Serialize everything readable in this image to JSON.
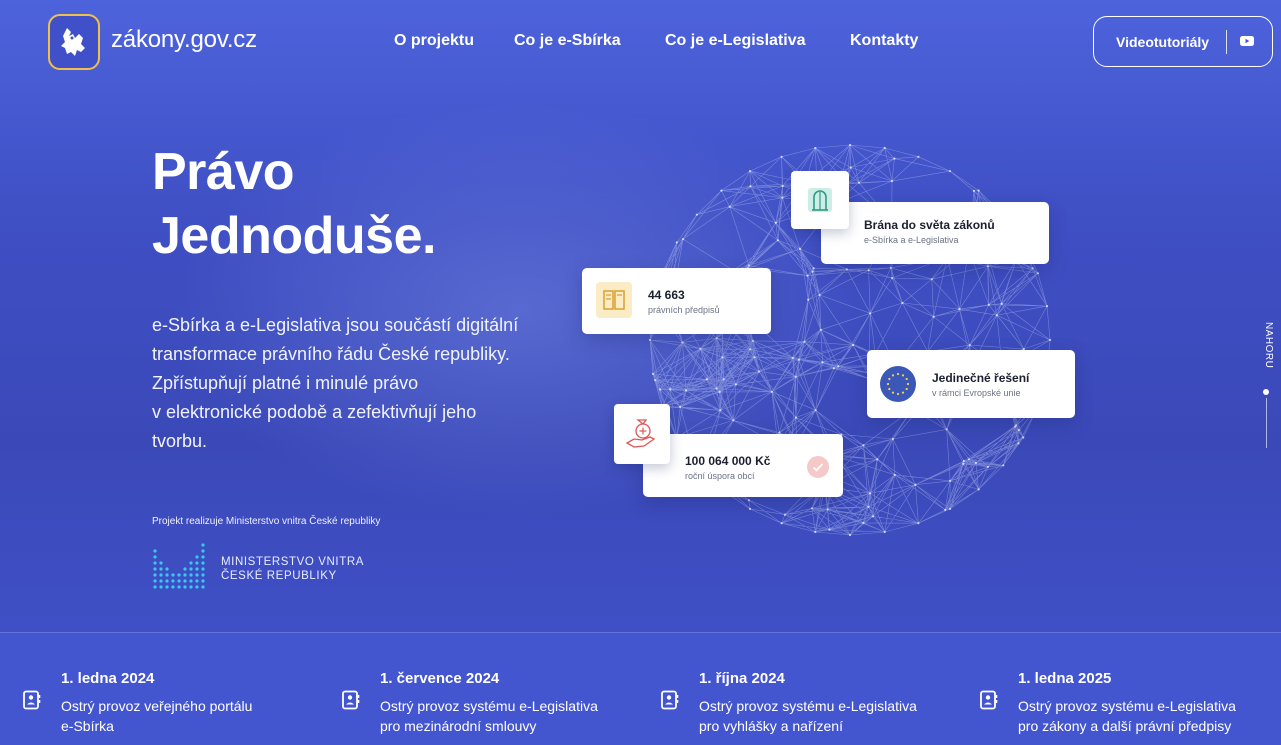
{
  "header": {
    "site_name": "zákony.gov.cz",
    "nav": [
      "O projektu",
      "Co je e-Sbírka",
      "Co je e-Legislativa",
      "Kontakty"
    ],
    "video_button": "Videotutoriály"
  },
  "hero": {
    "headline_line1": "Právo",
    "headline_line2": "Jednoduše.",
    "lead": [
      "e-Sbírka a e-Legislativa jsou součástí digitální",
      "transformace právního řádu České republiky.",
      "Zpřístupňují platné i minulé právo",
      "v elektronické podobě a zefektivňují jeho",
      "tvorbu."
    ],
    "realizuje": "Projekt realizuje Ministerstvo vnitra České republiky",
    "ministry_line1": "MINISTERSTVO VNITRA",
    "ministry_line2": "ČESKÉ REPUBLIKY"
  },
  "cards": {
    "brana": {
      "title": "Brána do světa zákonů",
      "subtitle": "e-Sbírka a e-Legislativa"
    },
    "predpisy": {
      "title": "44 663",
      "subtitle": "právních předpisů"
    },
    "reseni": {
      "title": "Jedinečné řešení",
      "subtitle": "v rámci Evropské unie"
    },
    "uspora": {
      "title": "100 064 000 Kč",
      "subtitle": "roční úspora obcí"
    }
  },
  "scroll_top": "NAHORU",
  "timeline": [
    {
      "date": "1. ledna 2024",
      "line1": "Ostrý provoz veřejného portálu",
      "line2": "e-Sbírka"
    },
    {
      "date": "1. července 2024",
      "line1": "Ostrý provoz systému e-Legislativa",
      "line2": "pro mezinárodní smlouvy"
    },
    {
      "date": "1. října 2024",
      "line1": "Ostrý provoz systému e-Legislativa",
      "line2": "pro vyhlášky a nařízení"
    },
    {
      "date": "1. ledna 2025",
      "line1": "Ostrý provoz systému e-Legislativa",
      "line2": "pro zákony a další právní předpisy"
    }
  ],
  "colors": {
    "accent": "#f1c04a",
    "background": "#4356d0",
    "card": "#ffffff"
  }
}
